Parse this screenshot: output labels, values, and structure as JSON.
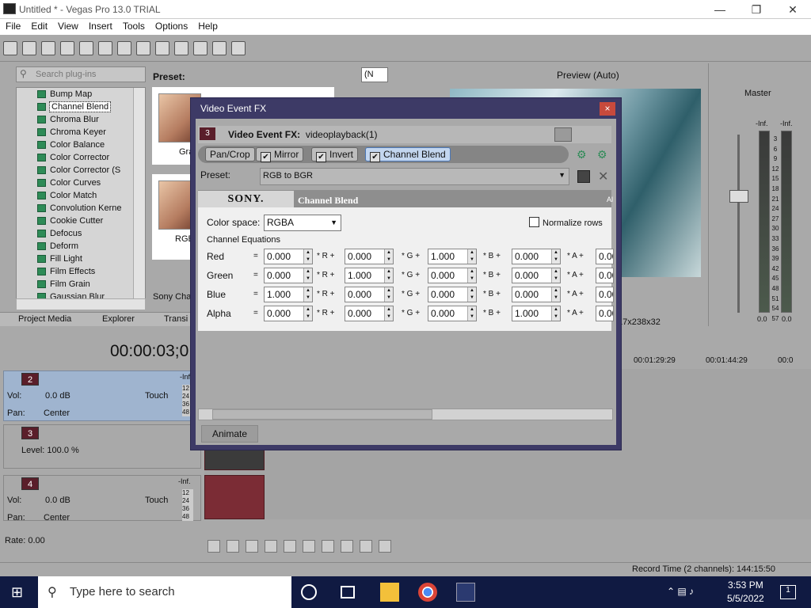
{
  "window": {
    "title": "Untitled * - Vegas Pro 13.0 TRIAL",
    "min_icon": "minimize-icon",
    "max_icon": "restore-icon",
    "close_icon": "close-icon"
  },
  "menu": [
    "File",
    "Edit",
    "View",
    "Insert",
    "Tools",
    "Options",
    "Help"
  ],
  "plugins": {
    "search_placeholder": "Search plug-ins",
    "items": [
      "Bump Map",
      "Channel Blend",
      "Chroma Blur",
      "Chroma Keyer",
      "Color Balance",
      "Color Corrector",
      "Color Corrector (S",
      "Color Curves",
      "Color Match",
      "Convolution Kerne",
      "Cookie Cutter",
      "Defocus",
      "Deform",
      "Fill Light",
      "Film Effects",
      "Film Grain",
      "Gaussian Blur"
    ],
    "selected": "Channel Blend",
    "preset_label": "Preset:",
    "preset_thumb1": "Gra",
    "preset_thumb2": "RGB",
    "preset_footer": "Sony Cha"
  },
  "tabs": [
    "Project Media",
    "Explorer",
    "Transi"
  ],
  "preview": {
    "label": "Preview (Auto)",
    "dropdown_value": "(N",
    "footer": "17x238x32"
  },
  "master": {
    "label": "Master",
    "inf_left": "-Inf.",
    "inf_right": "-Inf.",
    "scale": [
      "3",
      "6",
      "9",
      "12",
      "15",
      "18",
      "21",
      "24",
      "27",
      "30",
      "33",
      "36",
      "39",
      "42",
      "45",
      "48",
      "51",
      "54",
      "57"
    ],
    "bottom_left": "0.0",
    "bottom_right": "0.0"
  },
  "timeline": {
    "timecode": "00:00:03;0",
    "ruler": [
      "00:01:29:29",
      "00:01:44:29",
      "00:0"
    ],
    "tracks": [
      {
        "num": "2",
        "vol_label": "Vol:",
        "vol_value": "0.0 dB",
        "pan_label": "Pan:",
        "pan_value": "Center",
        "mode": "Touch",
        "inf": "-Inf"
      },
      {
        "num": "3",
        "level_label": "Level: 100.0 %"
      },
      {
        "num": "4",
        "vol_label": "Vol:",
        "vol_value": "0.0 dB",
        "pan_label": "Pan:",
        "pan_value": "Center",
        "mode": "Touch",
        "inf": "-Inf."
      }
    ],
    "meter_nums_1": [
      "12",
      "24",
      "36",
      "48"
    ],
    "meter_nums_2": [
      "12",
      "24",
      "36",
      "48"
    ],
    "rate": "Rate: 0.00",
    "status": "Record Time (2 channels): 144:15:50"
  },
  "dialog": {
    "title": "Video Event FX",
    "close": "×",
    "event_num": "3",
    "event_label": "Video Event FX:",
    "event_name": "videoplayback(1)",
    "chain": [
      "Pan/Crop",
      "Mirror",
      "Invert",
      "Channel Blend"
    ],
    "preset_label": "Preset:",
    "preset_value": "RGB to BGR",
    "sony": "SONY.",
    "fx_name": "Channel Blend",
    "fx_right": "Al",
    "color_space_label": "Color space:",
    "color_space_value": "RGBA",
    "normalize_label": "Normalize rows",
    "normalize_checked": false,
    "equations_heading": "Channel Equations",
    "eq_signs": [
      "=",
      "* R +",
      "* G +",
      "* B +",
      "* A +"
    ],
    "rows": [
      {
        "label": "Red",
        "values": [
          "0.000",
          "0.000",
          "1.000",
          "0.000",
          "0.00"
        ]
      },
      {
        "label": "Green",
        "values": [
          "0.000",
          "1.000",
          "0.000",
          "0.000",
          "0.00"
        ]
      },
      {
        "label": "Blue",
        "values": [
          "1.000",
          "0.000",
          "0.000",
          "0.000",
          "0.00"
        ]
      },
      {
        "label": "Alpha",
        "values": [
          "0.000",
          "0.000",
          "0.000",
          "1.000",
          "0.00"
        ]
      }
    ],
    "animate": "Animate"
  },
  "taskbar": {
    "search_placeholder": "Type here to search",
    "time": "3:53 PM",
    "date": "5/5/2022",
    "notif_count": "1"
  },
  "colors": {
    "dialog_frame": "#3d3a66",
    "close_red": "#c84a3c",
    "active_chain": "#c3d6ef",
    "taskbar": "#101a42"
  }
}
